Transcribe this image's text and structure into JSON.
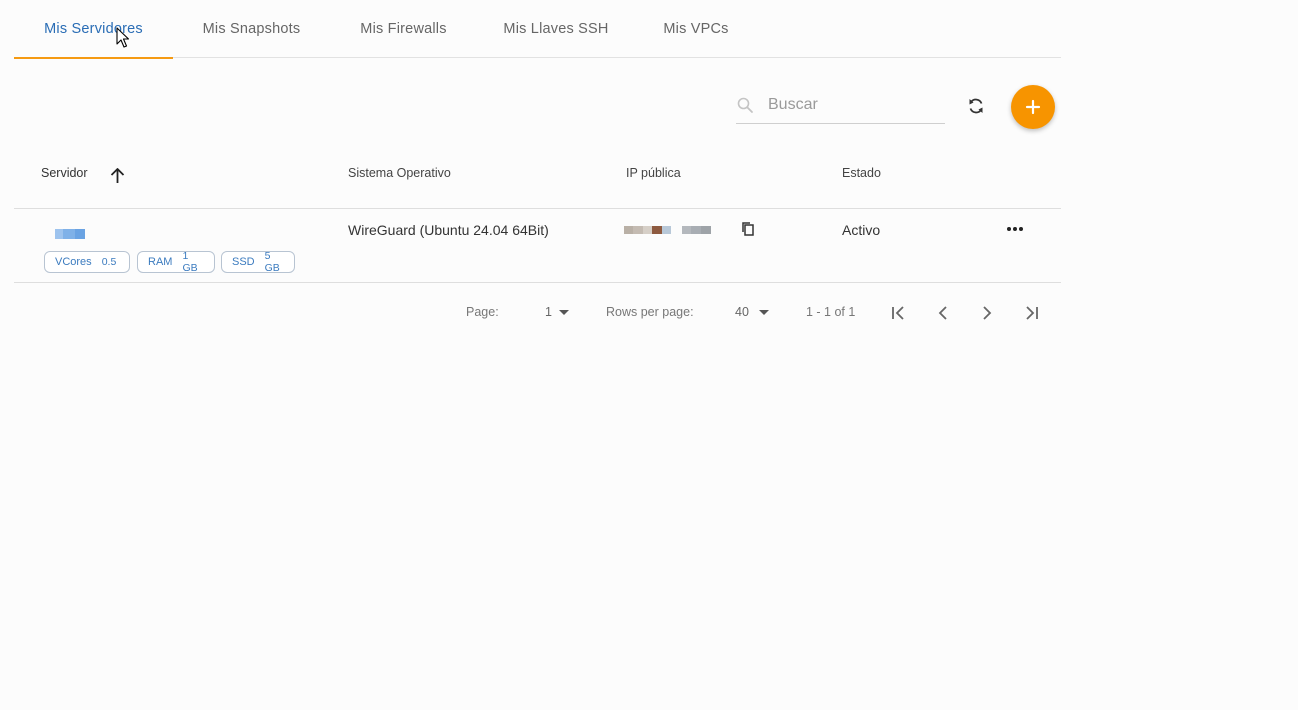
{
  "tabs": [
    {
      "label": "Mis Servidores",
      "active": true
    },
    {
      "label": "Mis Snapshots",
      "active": false
    },
    {
      "label": "Mis Firewalls",
      "active": false
    },
    {
      "label": "Mis Llaves SSH",
      "active": false
    },
    {
      "label": "Mis VPCs",
      "active": false
    }
  ],
  "toolbar": {
    "search_placeholder": "Buscar",
    "search_value": "",
    "refresh_icon": "refresh-icon",
    "add_icon": "plus-icon",
    "accent_color": "#f79400"
  },
  "table": {
    "columns": [
      "Servidor",
      "Sistema Operativo",
      "IP pública",
      "Estado"
    ],
    "sort_icon": "arrow-up-icon",
    "rows": [
      {
        "server_name": "",
        "specs": [
          {
            "label": "VCores",
            "value": "0.5"
          },
          {
            "label": "RAM",
            "value": "1 GB"
          },
          {
            "label": "SSD",
            "value": "5 GB"
          }
        ],
        "os": "WireGuard (Ubuntu 24.04 64Bit)",
        "ip": "",
        "state": "Activo"
      }
    ]
  },
  "pagination": {
    "page_label": "Page:",
    "page_value": "1",
    "rows_label": "Rows per page:",
    "rows_value": "40",
    "range": "1 - 1 of 1"
  },
  "colors": {
    "active_tab": "#2a6db5",
    "tab_underline": "#f59a12",
    "chip_text": "#3b7bbf"
  }
}
